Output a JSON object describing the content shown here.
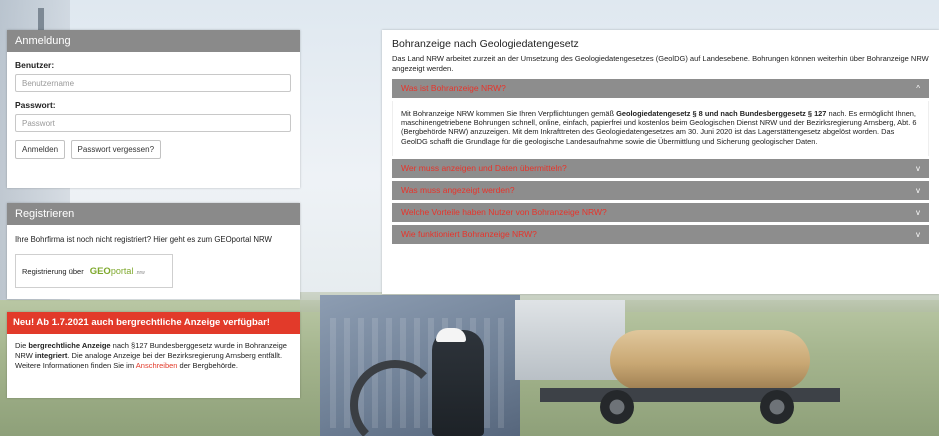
{
  "login": {
    "title": "Anmeldung",
    "user_label": "Benutzer:",
    "user_placeholder": "Benutzername",
    "password_label": "Passwort:",
    "password_placeholder": "Passwort",
    "login_button": "Anmelden",
    "forgot_button": "Passwort vergessen?"
  },
  "register": {
    "title": "Registrieren",
    "intro": "Ihre Bohrfirma ist noch nicht registriert? Hier geht es zum GEOportal NRW",
    "link_text": "Registrierung über",
    "logo": {
      "geo": "GEO",
      "portal": "portal",
      "suffix": ".nrw"
    }
  },
  "notice": {
    "title": "Neu! Ab 1.7.2021 auch bergrechtliche Anzeige verfügbar!",
    "p1": "Die ",
    "p1_bold": "bergrechtliche Anzeige",
    "p2": " nach §127 Bundesberggesetz wurde in Bohranzeige NRW ",
    "p2_bold": "integriert",
    "p3": ". Die analoge Anzeige bei der Bezirksregierung Arnsberg entfällt. Weitere Informationen finden Sie im ",
    "link": "Anschreiben",
    "p4": " der Bergbehörde."
  },
  "main": {
    "title": "Bohranzeige nach Geologiedatengesetz",
    "lead": "Das Land NRW arbeitet zurzeit an der Umsetzung des Geologiedatengesetzes (GeolDG) auf Landesebene. Bohrungen können weiterhin über Bohranzeige NRW angezeigt werden.",
    "accordion": [
      {
        "title": "Was ist Bohranzeige NRW?",
        "icon": "chevron-up-icon",
        "chev": "^"
      },
      {
        "title": "Wer muss anzeigen und Daten übermitteln?",
        "icon": "chevron-down-icon",
        "chev": "v"
      },
      {
        "title": "Was muss angezeigt werden?",
        "icon": "chevron-down-icon",
        "chev": "v"
      },
      {
        "title": "Welche Vorteile haben Nutzer von Bohranzeige NRW?",
        "icon": "chevron-down-icon",
        "chev": "v"
      },
      {
        "title": "Wie funktioniert Bohranzeige NRW?",
        "icon": "chevron-down-icon",
        "chev": "v"
      }
    ],
    "open_body": {
      "t1": "Mit Bohranzeige NRW kommen Sie Ihren Verpflichtungen gemäß ",
      "b1": "Geologiedatengesetz § 8 und nach Bundesberggesetz § 127",
      "t2": " nach. Es ermöglicht Ihnen, maschinengetriebene Bohrungen schnell, online, einfach, papierfrei und kostenlos beim Geologischen Dienst NRW und der Bezirksregierung Arnsberg, Abt. 6 (Bergbehörde NRW) anzuzeigen. Mit dem Inkrafttreten des Geologiedatengesetzes am 30. Juni 2020 ist das Lagerstättengesetz abgelöst worden. Das GeolDG schafft die Grundlage für die geologische Landesaufnahme sowie die Übermittlung und Sicherung geologischer Daten."
    }
  },
  "colors": {
    "accent_red": "#e23a2a",
    "header_gray": "#8a8a8a",
    "logo_green": "#7ea82c"
  }
}
